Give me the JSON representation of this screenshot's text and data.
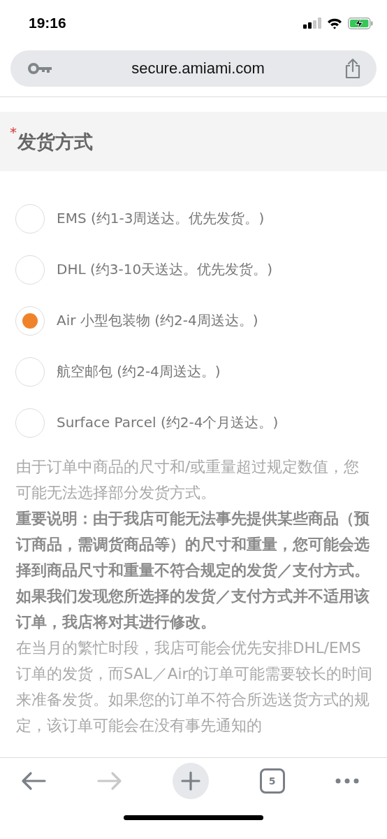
{
  "status_bar": {
    "time": "19:16"
  },
  "address_bar": {
    "url": "secure.amiami.com"
  },
  "section": {
    "title": "发货方式",
    "required": true,
    "required_mark": "*"
  },
  "options": [
    {
      "label": "EMS (约1-3周送达。优先发货。)",
      "selected": false
    },
    {
      "label": "DHL (约3-10天送达。优先发货。)",
      "selected": false
    },
    {
      "label": "Air 小型包装物 (约2-4周送达。)",
      "selected": true
    },
    {
      "label": "航空邮包 (约2-4周送达。)",
      "selected": false
    },
    {
      "label": "Surface Parcel (约2-4个月送达。)",
      "selected": false
    }
  ],
  "notes": [
    {
      "kind": "normal",
      "text": "由于订单中商品的尺寸和/或重量超过规定数值，您可能无法选择部分发货方式。"
    },
    {
      "kind": "important",
      "text": "重要说明：由于我店可能无法事先提供某些商品（预订商品，需调货商品等）的尺寸和重量，您可能会选择到商品尺寸和重量不符合规定的发货／支付方式。如果我们发现您所选择的发货／支付方式并不适用该订单，我店将对其进行修改。"
    },
    {
      "kind": "normal",
      "text": "在当月的繁忙时段，我店可能会优先安排DHL/EMS订单的发货，而SAL／Air的订单可能需要较长的时间来准备发货。如果您的订单不符合所选送货方式的规定，该订单可能会在没有事先通知的"
    }
  ],
  "toolbar": {
    "back_disabled": false,
    "forward_disabled": true,
    "tab_count": "5"
  }
}
